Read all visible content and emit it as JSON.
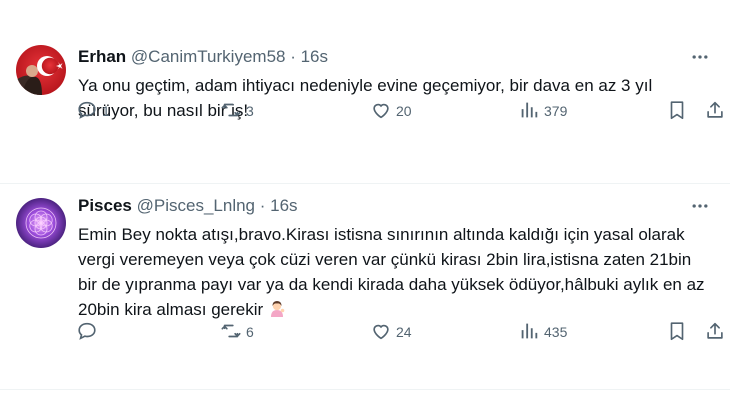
{
  "tweets": [
    {
      "name": "Erhan",
      "handle": "@CanimTurkiyem58",
      "sep": " · ",
      "time": "16s",
      "text": "Ya onu geçtim, adam ihtiyacı nedeniyle evine geçemiyor, bir dava en az 3 yıl sürüyor, bu nasıl bir iş!",
      "replies": "1",
      "reposts": "3",
      "likes": "20",
      "views": "379"
    },
    {
      "name": "Pisces",
      "handle": "@Pisces_Lnlng",
      "sep": " · ",
      "time": "16s",
      "text": "Emin Bey nokta atışı,bravo.Kirası istisna sınırının altında kaldığı için yasal olarak vergi veremeyen veya çok cüzi veren var çünkü kirası 2bin lira,istisna zaten 21bin bir de yıpranma payı var ya da kendi kirada daha yüksek ödüyor,hâlbuki aylık en az 20bin kira alması gerekir",
      "replies": "",
      "reposts": "6",
      "likes": "24",
      "views": "435"
    }
  ],
  "icons": {
    "more": "more-horizontal-icon",
    "reply": "reply-icon",
    "repost": "repost-icon",
    "like": "heart-icon",
    "views": "bar-chart-icon",
    "bookmark": "bookmark-icon",
    "share": "share-icon",
    "emoji": "woman-tipping-hand-emoji"
  },
  "colors": {
    "text": "#0f1419",
    "secondary": "#536471",
    "divider": "#eff3f4"
  }
}
